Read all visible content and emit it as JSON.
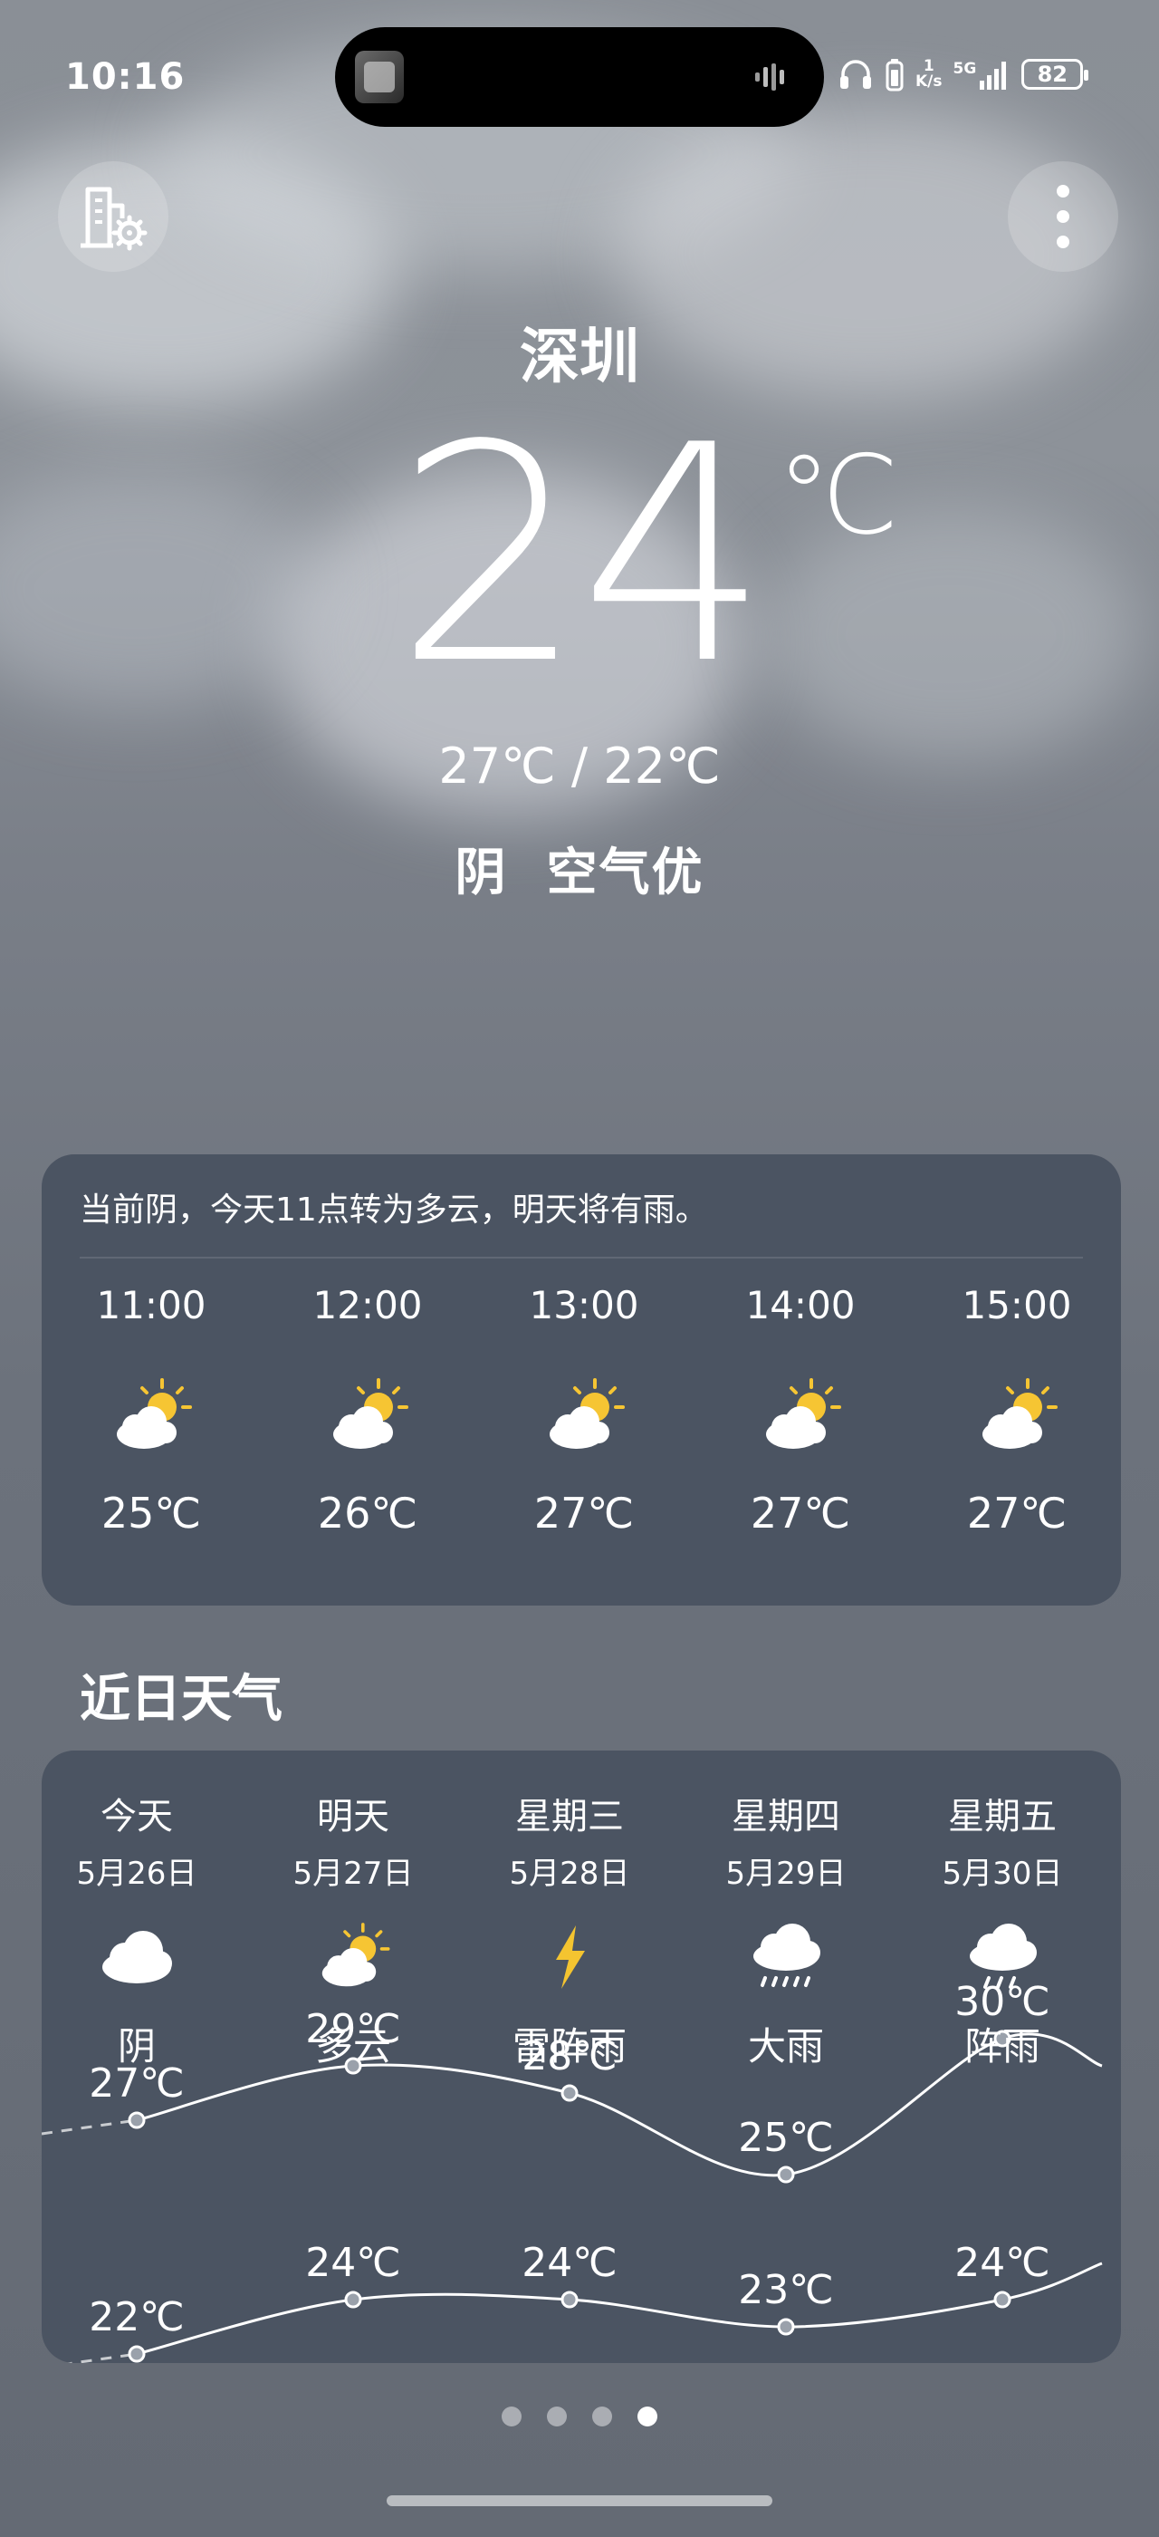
{
  "status_bar": {
    "time": "10:16",
    "net_speed_value": "1",
    "net_speed_unit": "K/s",
    "network": "5G",
    "battery": "82"
  },
  "header": {
    "city": "深圳",
    "temperature": "24",
    "unit": "℃",
    "high_low": "27℃ / 22℃",
    "condition": "阴  空气优"
  },
  "hourly": {
    "summary": "当前阴，今天11点转为多云，明天将有雨。",
    "items": [
      {
        "time": "11:00",
        "icon": "partly-cloudy-icon",
        "temp": "25℃"
      },
      {
        "time": "12:00",
        "icon": "partly-cloudy-icon",
        "temp": "26℃"
      },
      {
        "time": "13:00",
        "icon": "partly-cloudy-icon",
        "temp": "27℃"
      },
      {
        "time": "14:00",
        "icon": "partly-cloudy-icon",
        "temp": "27℃"
      },
      {
        "time": "15:00",
        "icon": "partly-cloudy-icon",
        "temp": "27℃"
      }
    ]
  },
  "forecast": {
    "title": "近日天气",
    "days": [
      {
        "name": "今天",
        "date": "5月26日",
        "icon": "cloudy-icon",
        "cond": "阴",
        "high": "27℃",
        "low": "22℃"
      },
      {
        "name": "明天",
        "date": "5月27日",
        "icon": "partly-cloudy-icon",
        "cond": "多云",
        "high": "29℃",
        "low": "24℃"
      },
      {
        "name": "星期三",
        "date": "5月28日",
        "icon": "thunder-icon",
        "cond": "雷阵雨",
        "high": "28℃",
        "low": "24℃"
      },
      {
        "name": "星期四",
        "date": "5月29日",
        "icon": "heavy-rain-icon",
        "cond": "大雨",
        "high": "25℃",
        "low": "23℃"
      },
      {
        "name": "星期五",
        "date": "5月30日",
        "icon": "shower-icon",
        "cond": "阵雨",
        "high": "30℃",
        "low": "24℃"
      }
    ]
  },
  "pager": {
    "count": 4,
    "active": 3
  },
  "colors": {
    "card": "#4b5462",
    "sun": "#f6c533",
    "thunder": "#f4c430"
  }
}
